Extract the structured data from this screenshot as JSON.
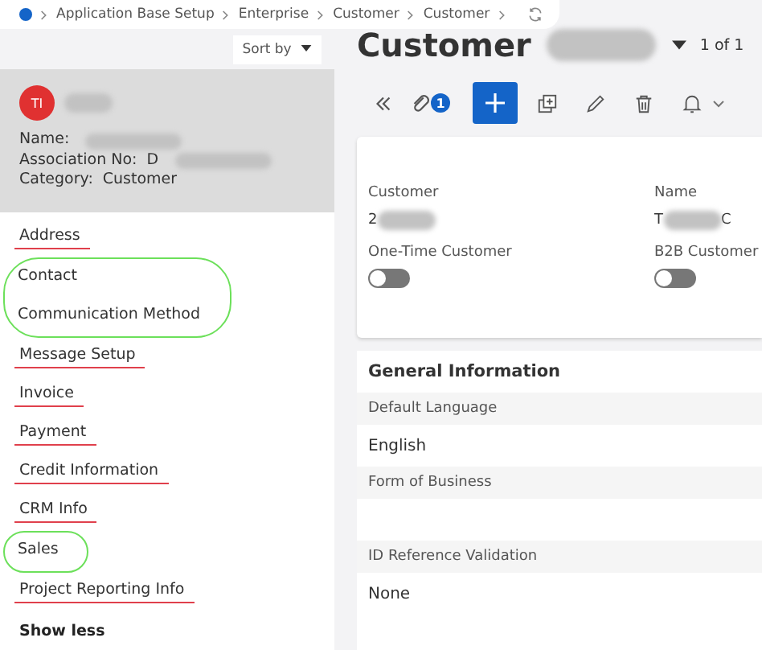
{
  "breadcrumb": {
    "items": [
      "Application Base Setup",
      "Enterprise",
      "Customer",
      "Customer"
    ]
  },
  "sidebar": {
    "sort_label": "Sort by",
    "card": {
      "initials": "TI",
      "name_redacted": true,
      "fields": [
        {
          "label": "Name:",
          "redacted": true
        },
        {
          "label": "Association No:",
          "value": "D",
          "redacted": true
        },
        {
          "label": "Category:",
          "value": "Customer"
        }
      ]
    },
    "items": [
      {
        "kind": "item",
        "label": "Address",
        "struck": true
      },
      {
        "kind": "circled",
        "items": [
          {
            "label": "Contact",
            "struck": false
          },
          {
            "label": "Communication Method",
            "struck": false
          }
        ]
      },
      {
        "kind": "item",
        "label": "Message Setup",
        "struck": true
      },
      {
        "kind": "item",
        "label": "Invoice",
        "struck": true
      },
      {
        "kind": "item",
        "label": "Payment",
        "struck": true
      },
      {
        "kind": "item",
        "label": "Credit Information",
        "struck": true
      },
      {
        "kind": "item",
        "label": "CRM Info",
        "struck": true
      },
      {
        "kind": "circled",
        "items": [
          {
            "label": "Sales",
            "struck": false
          }
        ]
      },
      {
        "kind": "item",
        "label": "Project Reporting Info",
        "struck": true
      }
    ],
    "show_less": "Show less"
  },
  "header": {
    "title": "Customer",
    "title_redacted": true,
    "pager": "1 of 1",
    "attachments": "1"
  },
  "summary": {
    "fields": [
      {
        "label": "Customer",
        "prefix": "2",
        "redacted": true
      },
      {
        "label": "Name",
        "prefix": "T",
        "suffix": "C",
        "redacted": true
      }
    ],
    "toggles": [
      {
        "label": "One-Time Customer",
        "on": false
      },
      {
        "label": "B2B Customer",
        "on": false
      }
    ]
  },
  "general": {
    "title": "General Information",
    "fields": [
      {
        "label": "Default Language",
        "value": "English"
      },
      {
        "label": "Form of Business"
      },
      {
        "label": "ID Reference Validation",
        "value": "None"
      }
    ]
  }
}
